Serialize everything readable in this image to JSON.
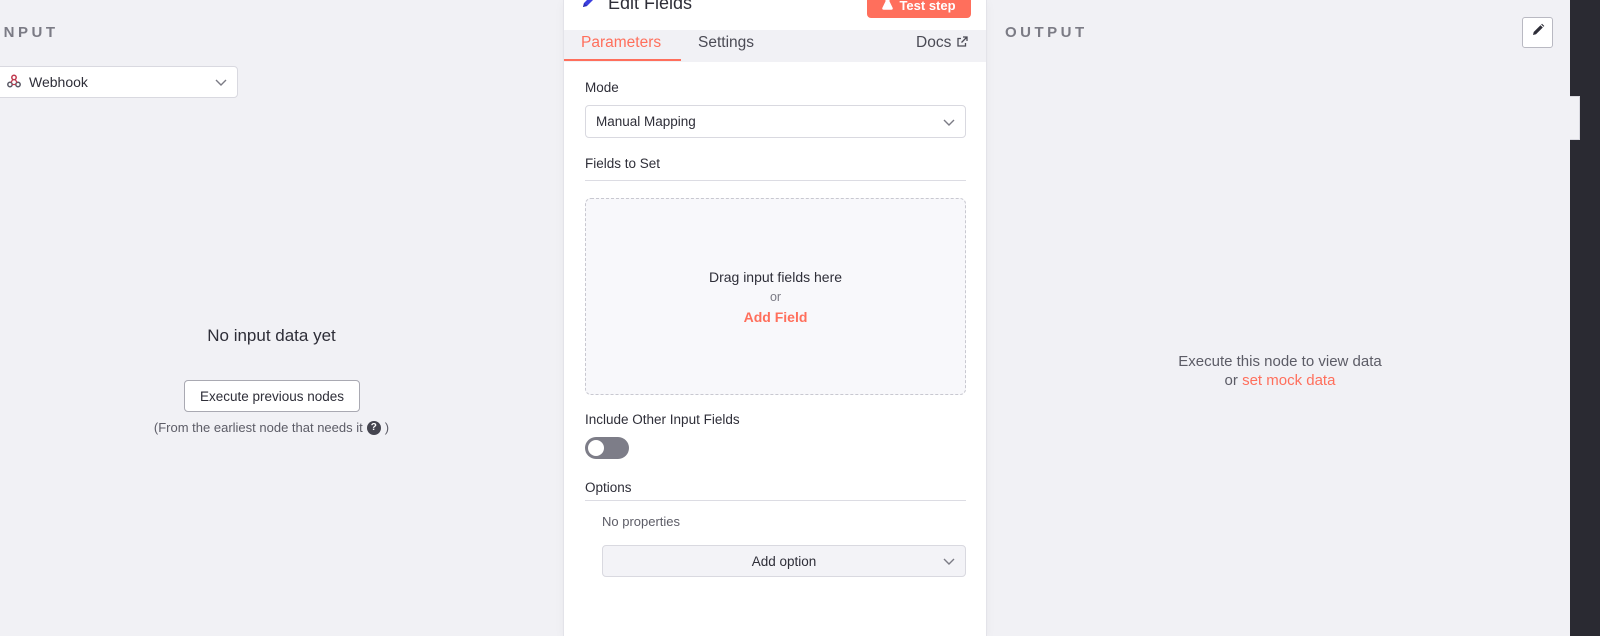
{
  "input": {
    "header": "INPUT",
    "source_select": "Webhook",
    "empty_title": "No input data yet",
    "execute_button": "Execute previous nodes",
    "hint": "(From the earliest node that needs it",
    "hint_close": ")"
  },
  "node": {
    "title": "Edit Fields",
    "test_step_label": "Test step",
    "tabs": [
      {
        "label": "Parameters",
        "active": true
      },
      {
        "label": "Settings",
        "active": false
      }
    ],
    "docs_label": "Docs",
    "mode_label": "Mode",
    "mode_value": "Manual Mapping",
    "fields_to_set_label": "Fields to Set",
    "dropzone_text": "Drag input fields here",
    "dropzone_or": "or",
    "add_field_label": "Add Field",
    "include_other_label": "Include Other Input Fields",
    "include_other_enabled": false,
    "options_label": "Options",
    "no_properties": "No properties",
    "add_option_label": "Add option"
  },
  "output": {
    "header": "OUTPUT",
    "message": "Execute this node to view data",
    "or_text": "or",
    "mock_link": "set mock data"
  },
  "colors": {
    "accent": "#ff6f5c",
    "background": "#f1f1f5",
    "panel": "#ffffff",
    "toggle_off": "#7d7d88",
    "title_icon": "#3b3fe0"
  },
  "icons": {
    "webhook": "webhook-icon",
    "edit_fields": "pencil-icon",
    "test_step": "flask-icon",
    "docs": "external-link-icon",
    "edit_output": "pencil-icon",
    "help": "question-circle-icon",
    "dropdown": "chevron-down-icon"
  }
}
